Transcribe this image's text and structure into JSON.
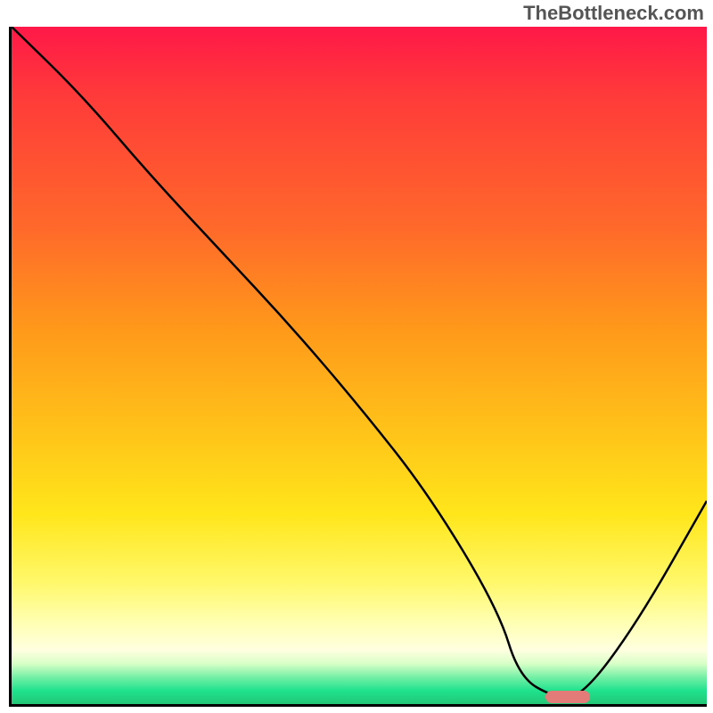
{
  "watermark": "TheBottleneck.com",
  "chart_data": {
    "type": "line",
    "title": "",
    "xlabel": "",
    "ylabel": "",
    "xlim": [
      0,
      100
    ],
    "ylim": [
      0,
      100
    ],
    "grid": false,
    "series": [
      {
        "name": "curve",
        "x": [
          0,
          10,
          20,
          30,
          40,
          50,
          60,
          70,
          73,
          78,
          82,
          90,
          100
        ],
        "values": [
          100,
          90,
          78,
          67,
          56,
          44,
          31,
          14,
          4,
          1,
          1,
          12,
          30
        ]
      }
    ],
    "marker": {
      "x": 80,
      "y": 1,
      "color": "#e37b78"
    },
    "background_gradient": [
      {
        "stop": 0.0,
        "color": "#ff1848"
      },
      {
        "stop": 0.1,
        "color": "#ff3a3a"
      },
      {
        "stop": 0.3,
        "color": "#ff6a2a"
      },
      {
        "stop": 0.45,
        "color": "#ff9a1a"
      },
      {
        "stop": 0.6,
        "color": "#ffc419"
      },
      {
        "stop": 0.72,
        "color": "#ffe61b"
      },
      {
        "stop": 0.82,
        "color": "#fff86a"
      },
      {
        "stop": 0.88,
        "color": "#ffffb3"
      },
      {
        "stop": 0.92,
        "color": "#ffffe0"
      },
      {
        "stop": 0.94,
        "color": "#d9ffc7"
      },
      {
        "stop": 0.96,
        "color": "#76f0a6"
      },
      {
        "stop": 0.98,
        "color": "#20e28e"
      },
      {
        "stop": 1.0,
        "color": "#22c776"
      }
    ]
  }
}
